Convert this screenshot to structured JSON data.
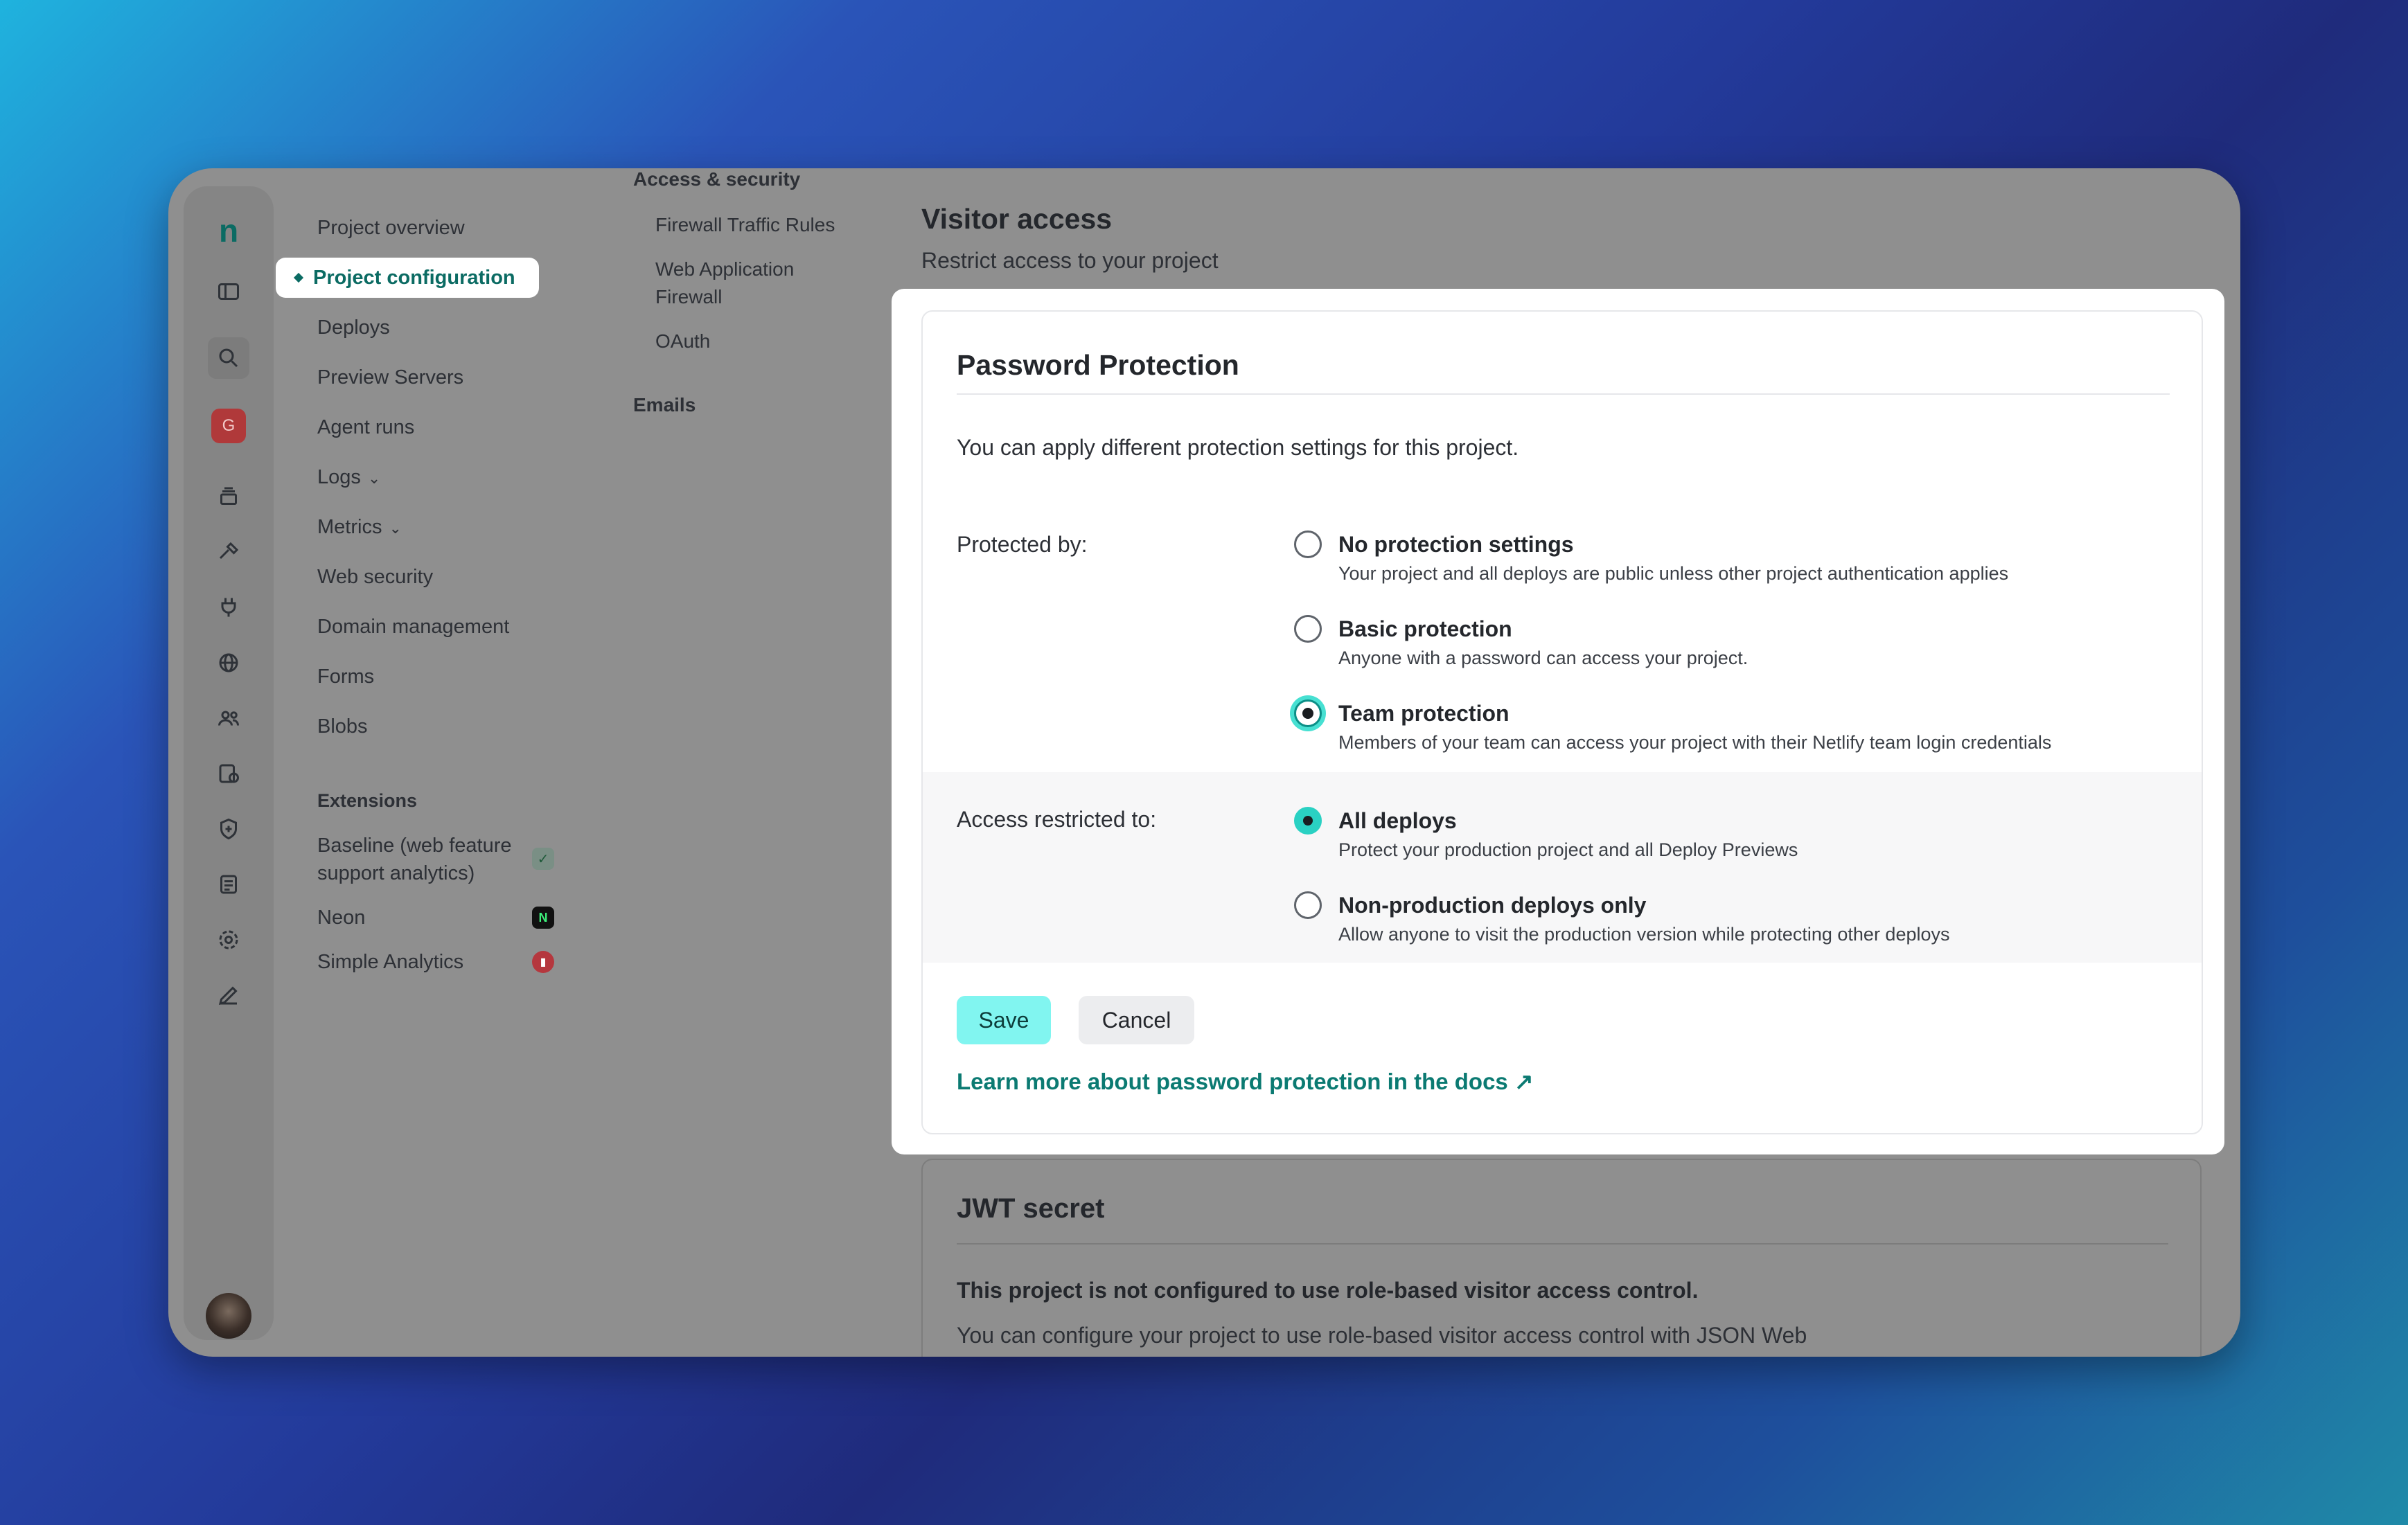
{
  "rail": {
    "logo": "n",
    "team_initial": "G"
  },
  "nav": {
    "items": [
      "Project overview",
      "Project configuration",
      "Deploys",
      "Preview Servers",
      "Agent runs",
      "Logs",
      "Metrics",
      "Web security",
      "Domain management",
      "Forms",
      "Blobs"
    ],
    "extensions_title": "Extensions",
    "extensions": [
      "Baseline (web feature support analytics)",
      "Neon",
      "Simple Analytics"
    ]
  },
  "subnav": {
    "section1": "Access & security",
    "items": [
      "Firewall Traffic Rules",
      "Web Application Firewall",
      "OAuth"
    ],
    "section2": "Emails"
  },
  "main": {
    "title": "Visitor access",
    "subtitle": "Restrict access to your project",
    "jwt_title": "JWT secret",
    "jwt_bold": "This project is not configured to use role-based visitor access control.",
    "jwt_text": "You can configure your project to use role-based visitor access control with JSON Web"
  },
  "modal": {
    "title": "Password Protection",
    "intro": "You can apply different protection settings for this project.",
    "protected_label": "Protected by:",
    "protection_options": [
      {
        "title": "No protection settings",
        "desc": "Your project and all deploys are public unless other project authentication applies"
      },
      {
        "title": "Basic protection",
        "desc": "Anyone with a password can access your project."
      },
      {
        "title": "Team protection",
        "desc": "Members of your team can access your project with their Netlify team login credentials"
      }
    ],
    "protection_selected": "Team protection",
    "access_label": "Access restricted to:",
    "access_options": [
      {
        "title": "All deploys",
        "desc": "Protect your production project and all Deploy Previews"
      },
      {
        "title": "Non-production deploys only",
        "desc": "Allow anyone to visit the production version while protecting other deploys"
      }
    ],
    "access_selected": "All deploys",
    "save_label": "Save",
    "cancel_label": "Cancel",
    "docs_link": "Learn more about password protection in the docs ↗"
  },
  "colors": {
    "accent": "#0b6b63",
    "save_button": "#81f5f0",
    "radio_selected": "#2ad1c3"
  }
}
